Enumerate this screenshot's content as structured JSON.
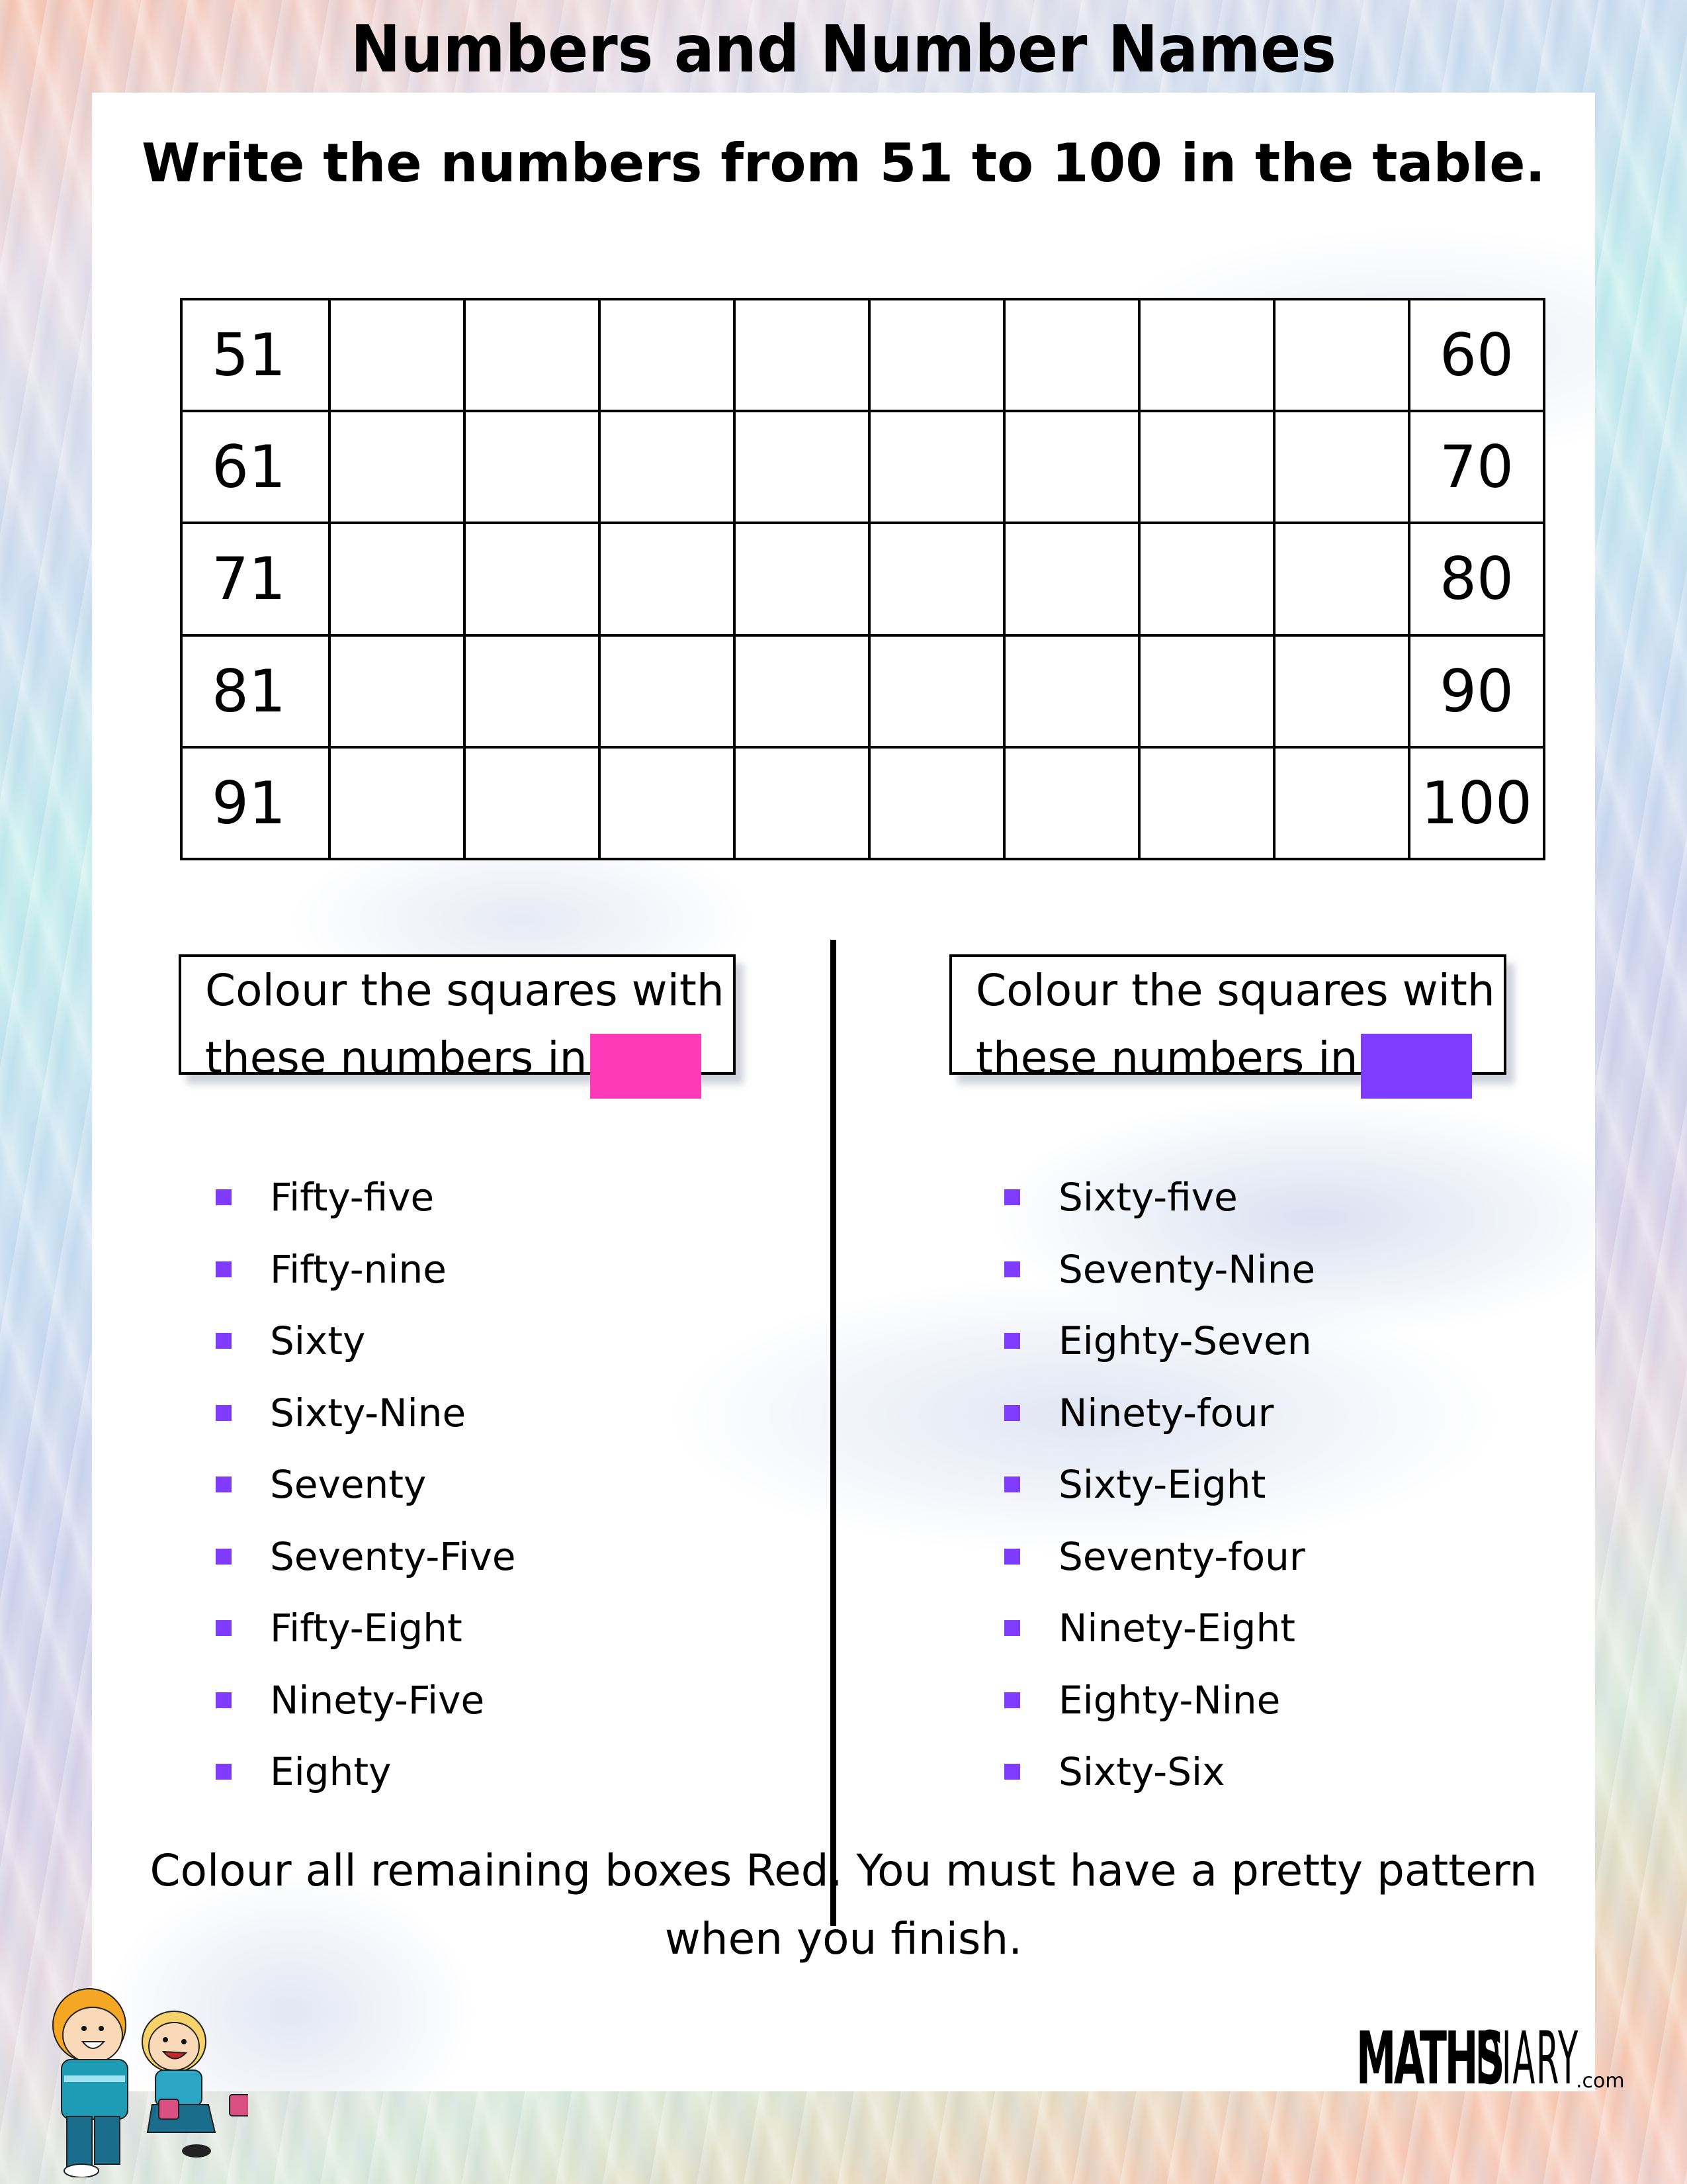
{
  "header": {
    "title": "Numbers and Number Names"
  },
  "instruction": "Write the numbers from 51 to 100 in the table.",
  "grid": {
    "columns": 10,
    "rows": [
      {
        "first": "51",
        "last": "60"
      },
      {
        "first": "61",
        "last": "70"
      },
      {
        "first": "71",
        "last": "80"
      },
      {
        "first": "81",
        "last": "90"
      },
      {
        "first": "91",
        "last": "100"
      }
    ]
  },
  "left_panel": {
    "line1": "Colour the squares with",
    "line2": "these numbers in",
    "swatch_color": "#ff3ab8",
    "items": [
      "Fifty-five",
      "Fifty-nine",
      "Sixty",
      "Sixty-Nine",
      "Seventy",
      "Seventy-Five",
      "Fifty-Eight",
      "Ninety-Five",
      "Eighty"
    ]
  },
  "right_panel": {
    "line1": "Colour the squares with",
    "line2": "these numbers in",
    "swatch_color": "#7f3cff",
    "items": [
      "Sixty-five",
      "Seventy-Nine",
      "Eighty-Seven",
      "Ninety-four",
      "Sixty-Eight",
      "Seventy-four",
      "Ninety-Eight",
      "Eighty-Nine",
      "Sixty-Six"
    ]
  },
  "bullet_color": "#7f3cff",
  "footer": {
    "line1": "Colour all remaining boxes Red. You must have a pretty pattern",
    "line2": "when you finish."
  },
  "logo": {
    "part1": "MATHS",
    "part2": "DIARY",
    "suffix": ".com"
  }
}
